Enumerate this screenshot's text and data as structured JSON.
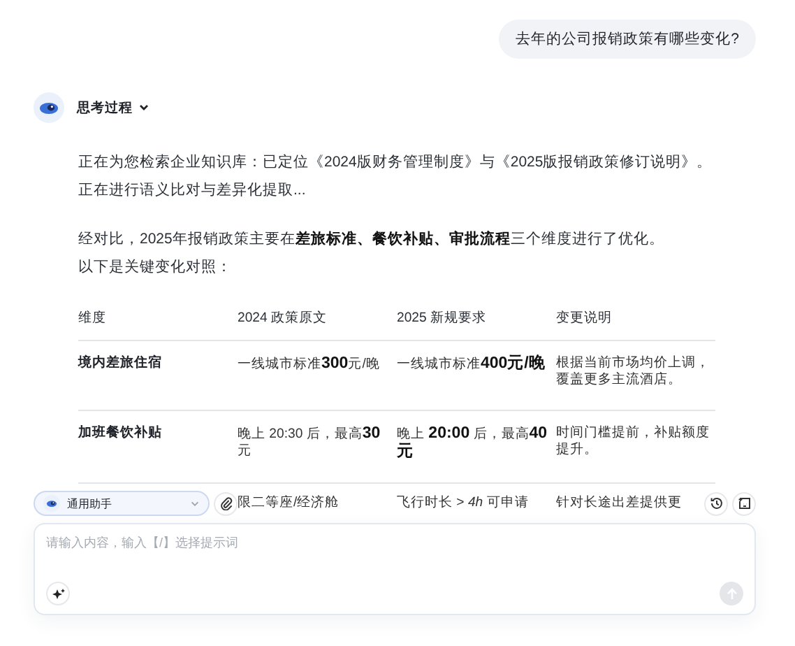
{
  "user_message": {
    "text": "去年的公司报销政策有哪些变化?"
  },
  "assistant": {
    "thinking_label": "思考过程",
    "thinking_expanded": false,
    "paragraphs": [
      {
        "lines": [
          "正在为您检索企业知识库：已定位《2024版财务管理制度》与《2025版报销政策修订说明》。",
          "正在进行语义比对与差异化提取..."
        ]
      },
      {
        "lines": [
          "经对比，2025年报销政策主要在**差旅标准、餐饮补贴、审批流程**三个维度进行了优化。",
          "以下是关键变化对照："
        ]
      }
    ],
    "table": {
      "columns": [
        "维度",
        "2024 政策原文",
        "2025 新规要求",
        "变更说明"
      ],
      "rows": [
        {
          "dimension": "境内差旅住宿",
          "policy_2024": "一线城市标准**300**元/晚",
          "policy_2025": "一线城市标准**400元/晚**",
          "note": "根据当前市场均价上调，覆盖更多主流酒店。"
        },
        {
          "dimension": "加班餐饮补贴",
          "policy_2024": "晚上 20:30 后，最高**30**元",
          "policy_2025": "晚上 **20:00** 后，最高**40元**",
          "note": "时间门槛提前，补贴额度提升。"
        },
        {
          "policy_2024": "限二等座/经济舱",
          "policy_2025": "飞行时长 > *4h* 可申请",
          "note": "针对长途出差提供更"
        }
      ]
    }
  },
  "composer": {
    "assistant_selector": "通用助手",
    "placeholder": "请输入内容，输入【/】选择提示词",
    "send_disabled": true
  }
}
